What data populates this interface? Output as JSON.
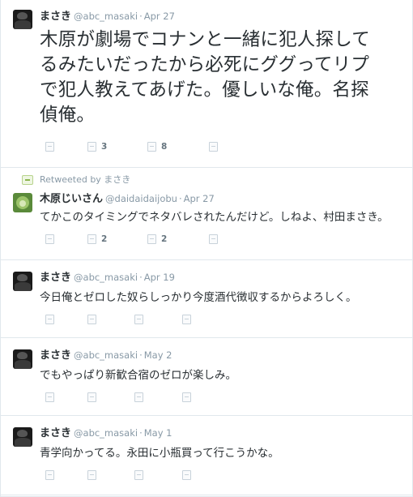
{
  "colors": {
    "text": "#292f33",
    "meta": "#8899a6",
    "divider": "#e1e8ed",
    "count": "#66757f"
  },
  "tweets": [
    {
      "name": "まさき",
      "handle": "@abc_masaki",
      "separator": "·",
      "time": "Apr 27",
      "text_lines": [
        "木原が劇場でコナンと一緒に犯人探して",
        "るみたいだったから必死にググってリプ",
        "で犯人教えてあげた。優しいな俺。名探",
        "偵俺。"
      ],
      "actions": {
        "reply_count": "",
        "retweet_count": "3",
        "favorite_count": "8",
        "more_count": ""
      }
    },
    {
      "retweeted_by": "Retweeted by まさき",
      "name": "木原じいさん",
      "handle": "@daidaidaijobu",
      "separator": "·",
      "time": "Apr 27",
      "text": "てかこのタイミングでネタバレされたんだけど。しねよ、村田まさき。",
      "actions": {
        "reply_count": "",
        "retweet_count": "2",
        "favorite_count": "2",
        "more_count": ""
      }
    },
    {
      "name": "まさき",
      "handle": "@abc_masaki",
      "separator": "·",
      "time": "Apr 19",
      "text": "今日俺とゼロした奴らしっかり今度酒代徴収するからよろしく。",
      "actions": {
        "reply_count": "",
        "retweet_count": "",
        "favorite_count": "",
        "more_count": ""
      }
    },
    {
      "name": "まさき",
      "handle": "@abc_masaki",
      "separator": "·",
      "time": "May 2",
      "text": "でもやっぱり新歓合宿のゼロが楽しみ。",
      "actions": {
        "reply_count": "",
        "retweet_count": "",
        "favorite_count": "",
        "more_count": ""
      }
    },
    {
      "name": "まさき",
      "handle": "@abc_masaki",
      "separator": "·",
      "time": "May 1",
      "text": "青学向かってる。永田に小瓶買って行こうかな。",
      "actions": {
        "reply_count": "",
        "retweet_count": "",
        "favorite_count": "",
        "more_count": ""
      }
    }
  ],
  "icons": {
    "avatar_1": "profile-photo",
    "avatar_2": "profile-photo",
    "retweet": "retweet-icon",
    "reply": "reply-icon",
    "favorite": "favorite-icon",
    "more": "more-icon"
  }
}
